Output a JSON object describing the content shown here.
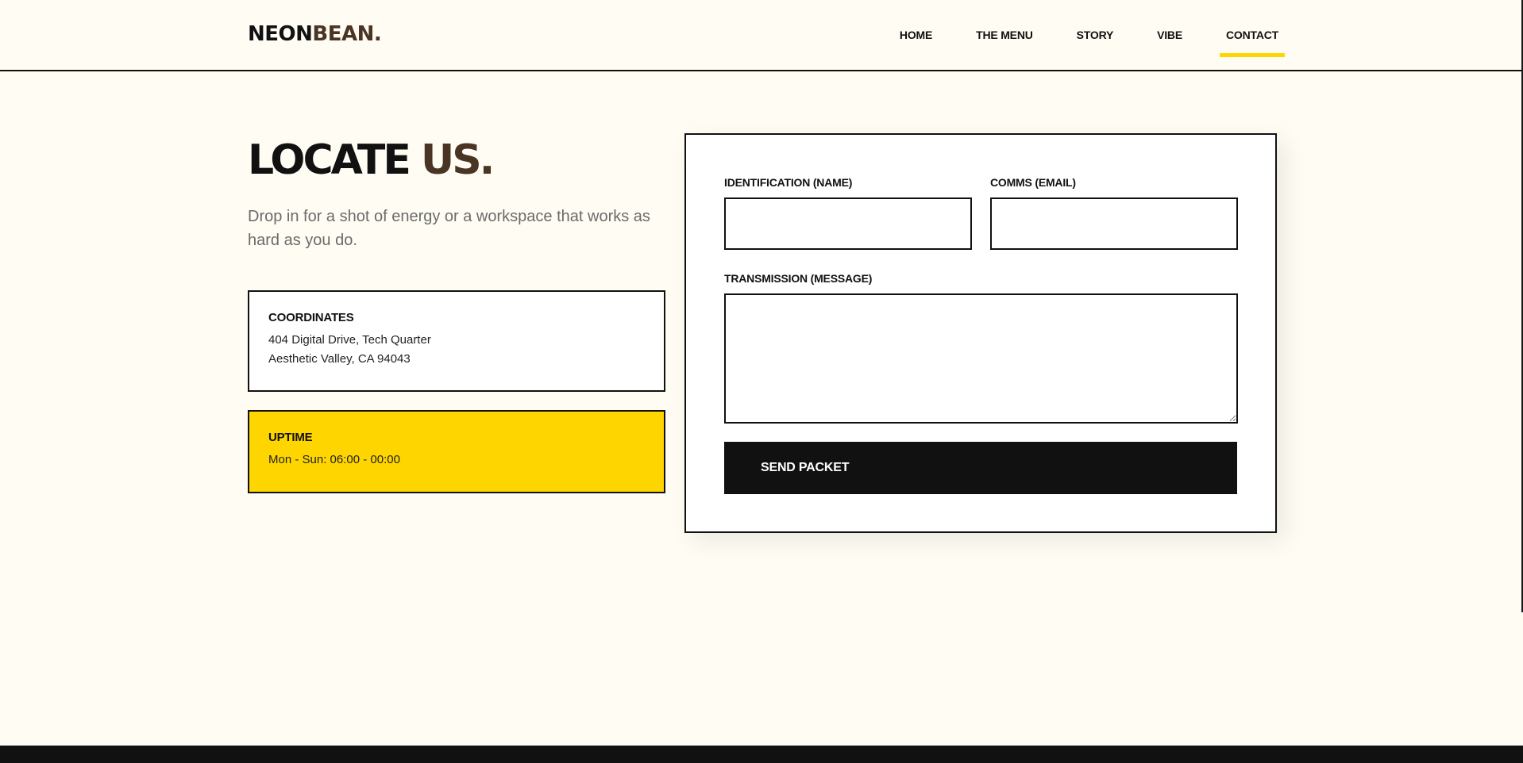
{
  "brand": {
    "logo_main": "NEON",
    "logo_accent": "BEAN."
  },
  "nav": {
    "items": [
      {
        "label": "HOME"
      },
      {
        "label": "THE MENU"
      },
      {
        "label": "STORY"
      },
      {
        "label": "VIBE"
      },
      {
        "label": "CONTACT",
        "active": true
      }
    ]
  },
  "hero": {
    "title_main": "LOCATE",
    "title_accent": "US.",
    "subtitle": "Drop in for a shot of energy or a workspace that works as hard as you do."
  },
  "coordinates": {
    "title": "COORDINATES",
    "line1": "404 Digital Drive, Tech Quarter",
    "line2": "Aesthetic Valley, CA 94043"
  },
  "uptime": {
    "title": "UPTIME",
    "hours": "Mon - Sun: 06:00 - 00:00"
  },
  "form": {
    "name_label": "IDENTIFICATION (NAME)",
    "name_value": "",
    "email_label": "COMMS (EMAIL)",
    "email_value": "",
    "message_label": "TRANSMISSION (MESSAGE)",
    "message_value": "",
    "submit_label": "SEND PACKET"
  },
  "colors": {
    "background": "#fffcf3",
    "accent_yellow": "#ffd500",
    "accent_brown": "#4a3424",
    "ink": "#111111"
  }
}
